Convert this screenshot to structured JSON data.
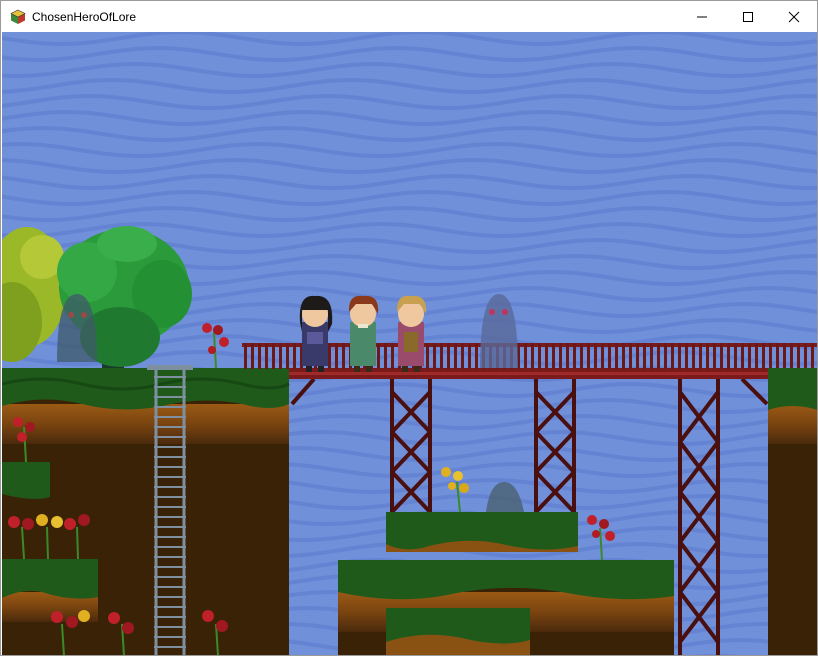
{
  "window": {
    "title": "ChosenHeroOfLore",
    "icon": "game-cube-icon",
    "controls": [
      "minimize-icon",
      "maximize-icon",
      "close-icon"
    ]
  },
  "scene": {
    "sky_color": "#6f8fd8",
    "wave_color": "#5a78cc",
    "grass_color": "#1f5a1a",
    "dirt_color": "#8a5212",
    "bridge_color": "#6b1818",
    "characters": [
      "hero-dark-hair",
      "hero-brown-hair",
      "hero-blonde-hair"
    ],
    "enemies": [
      "shadow-ghost",
      "shadow-ghost-in-tree",
      "shadow-mound"
    ]
  }
}
